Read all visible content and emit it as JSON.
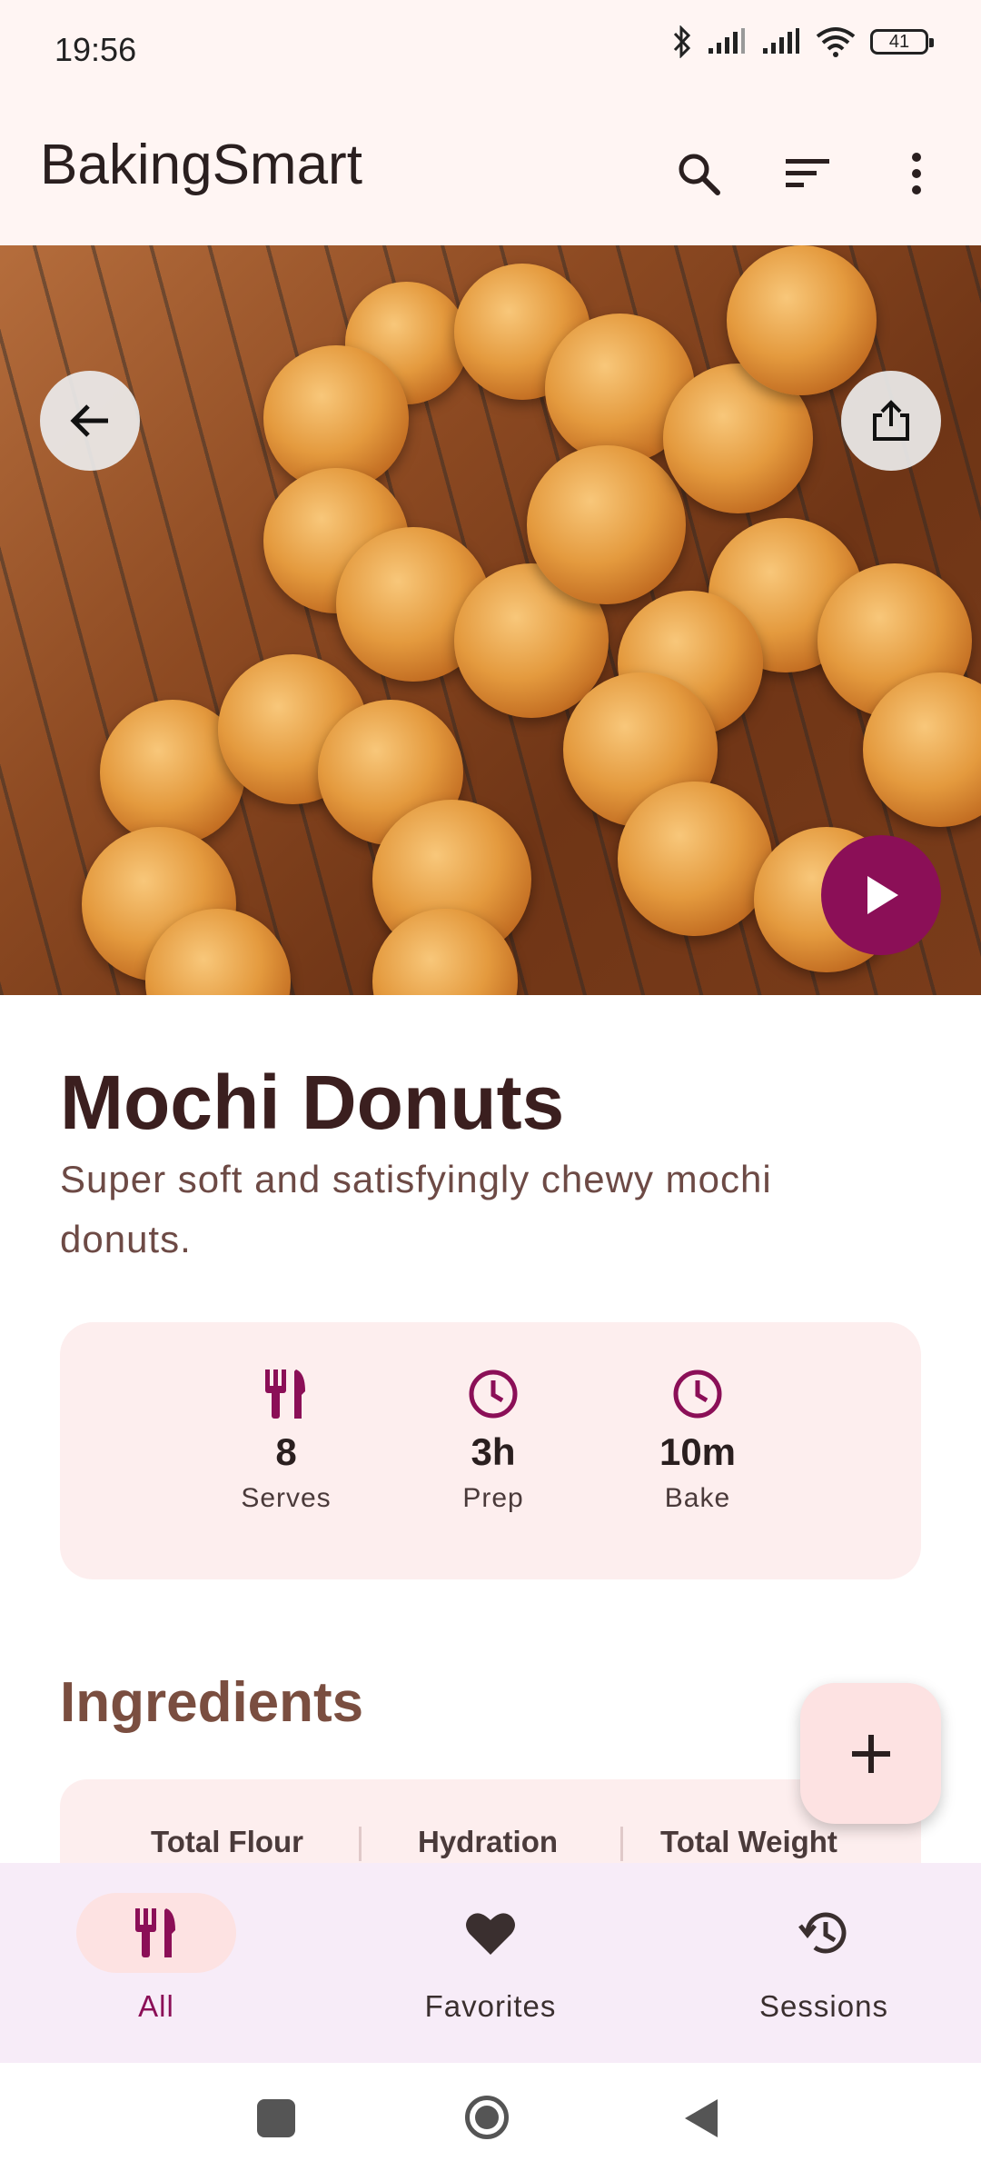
{
  "status_bar": {
    "time": "19:56",
    "battery": "41",
    "icons": [
      "bluetooth-icon",
      "signal-icon",
      "signal-icon",
      "wifi-icon",
      "battery-icon"
    ]
  },
  "app_bar": {
    "title": "BakingSmart",
    "actions": [
      "search-icon",
      "sort-icon",
      "more-vert-icon"
    ]
  },
  "hero": {
    "icons": [
      "back-arrow-icon",
      "share-icon",
      "play-icon"
    ]
  },
  "recipe": {
    "title": "Mochi Donuts",
    "description": "Super soft and satisfyingly chewy mochi donuts."
  },
  "stats": [
    {
      "icon": "utensils-icon",
      "value": "8",
      "label": "Serves"
    },
    {
      "icon": "clock-icon",
      "value": "3h",
      "label": "Prep"
    },
    {
      "icon": "clock-icon",
      "value": "10m",
      "label": "Bake"
    }
  ],
  "ingredients": {
    "title": "Ingredients",
    "columns": [
      "Total Flour",
      "Hydration",
      "Total Weight"
    ]
  },
  "fab": {
    "icon": "add-icon"
  },
  "bottom_nav": {
    "items": [
      {
        "label": "All",
        "icon": "utensils-icon",
        "selected": true
      },
      {
        "label": "Favorites",
        "icon": "heart-icon",
        "selected": false
      },
      {
        "label": "Sessions",
        "icon": "history-icon",
        "selected": false
      }
    ]
  },
  "colors": {
    "primary": "#8b0f57",
    "surface": "#fff5f3",
    "card": "#fdeeee",
    "nav_bg": "#f7ecf8",
    "nav_pill": "#fde2e2",
    "title_text": "#3b1f1f",
    "section_text": "#7a4e40"
  }
}
